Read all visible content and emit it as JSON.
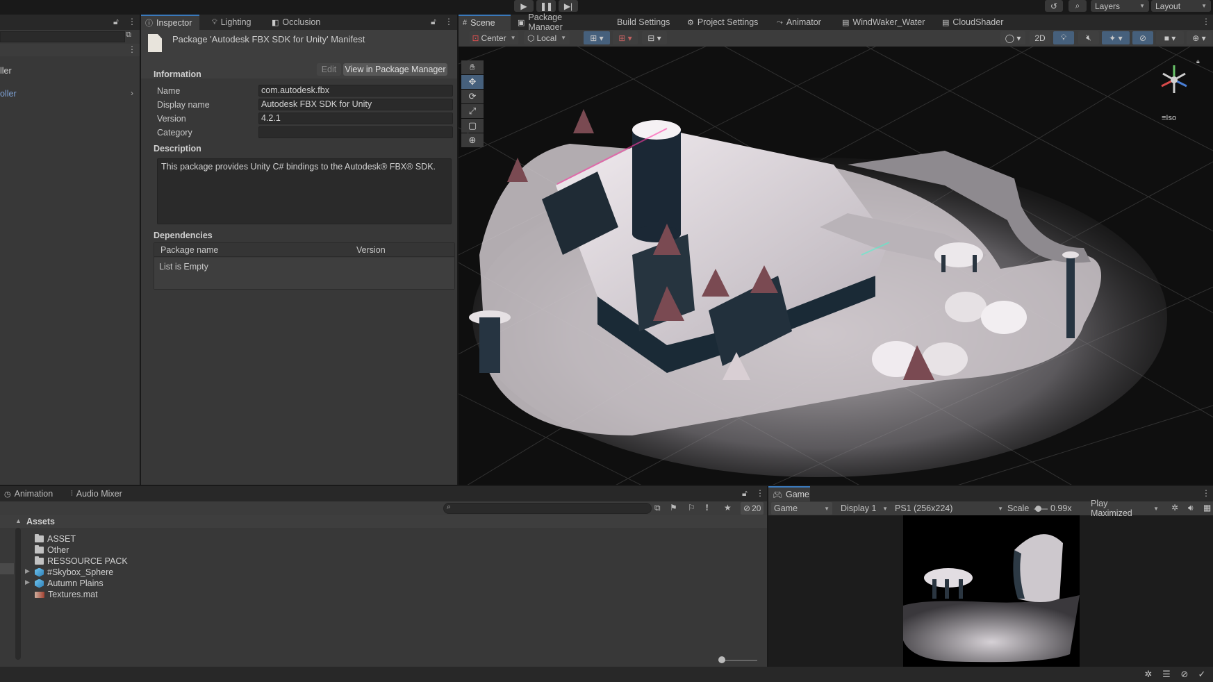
{
  "toolbar": {
    "play_icon": "play-icon",
    "pause_icon": "pause-icon",
    "step_icon": "step-icon",
    "layers_label": "Layers",
    "layout_label": "Layout"
  },
  "hierarchy": {
    "item1": "ller",
    "item2": "oller"
  },
  "inspector_tabs": [
    {
      "label": "Inspector",
      "icon": "info-icon"
    },
    {
      "label": "Lighting",
      "icon": "bulb-icon"
    },
    {
      "label": "Occlusion",
      "icon": "occlusion-icon"
    }
  ],
  "inspector": {
    "title": "Package 'Autodesk FBX SDK for Unity' Manifest",
    "edit_label": "Edit",
    "view_label": "View in Package Manager",
    "information_title": "Information",
    "fields": [
      {
        "label": "Name",
        "value": "com.autodesk.fbx"
      },
      {
        "label": "Display name",
        "value": "Autodesk FBX SDK for Unity"
      },
      {
        "label": "Version",
        "value": "4.2.1"
      },
      {
        "label": "Category",
        "value": ""
      }
    ],
    "description_title": "Description",
    "description": "This package provides Unity C# bindings to the Autodesk® FBX® SDK.",
    "dependencies_title": "Dependencies",
    "dep_col_name": "Package name",
    "dep_col_version": "Version",
    "dep_empty": "List is Empty"
  },
  "scene_tabs": [
    {
      "label": "Scene"
    },
    {
      "label": "Package Manager"
    },
    {
      "label": "Build Settings"
    },
    {
      "label": "Project Settings"
    },
    {
      "label": "Animator"
    },
    {
      "label": "WindWaker_Water"
    },
    {
      "label": "CloudShader"
    }
  ],
  "scene_toolbar": {
    "pivot": "Center",
    "space": "Local",
    "mode_2d": "2D",
    "iso_label": "Iso"
  },
  "bottom_tabs": [
    {
      "label": "Animation"
    },
    {
      "label": "Audio Mixer"
    }
  ],
  "project": {
    "hidden_count": "20",
    "root": "Assets",
    "items": [
      {
        "label": "ASSET",
        "type": "folder"
      },
      {
        "label": "Other",
        "type": "folder"
      },
      {
        "label": "RESSOURCE PACK",
        "type": "folder"
      },
      {
        "label": "#Skybox_Sphere",
        "type": "prefab"
      },
      {
        "label": "Autumn Plains",
        "type": "prefab"
      },
      {
        "label": "Textures.mat",
        "type": "material"
      }
    ]
  },
  "game": {
    "tab_label": "Game",
    "view_select": "Game",
    "display_select": "Display 1",
    "resolution_select": "PS1 (256x224)",
    "scale_label": "Scale",
    "scale_value": "0.99x",
    "play_mode": "Play Maximized"
  }
}
